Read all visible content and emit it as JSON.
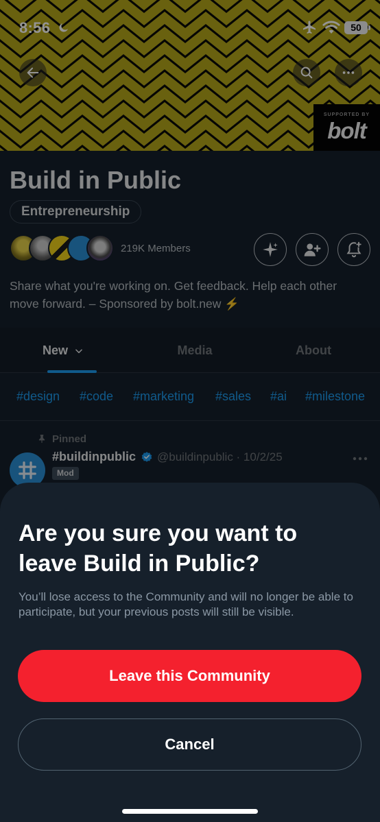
{
  "status_bar": {
    "time": "8:56",
    "battery": "50"
  },
  "banner": {
    "sponsor_small": "SUPPORTED BY",
    "sponsor_logo": "bolt"
  },
  "community": {
    "title": "Build in Public",
    "category": "Entrepreneurship",
    "members": "219K Members",
    "description": "Share what you're working on. Get feedback. Help each other move forward. – Sponsored by bolt.new ⚡"
  },
  "tabs": [
    {
      "label": "New"
    },
    {
      "label": "Media"
    },
    {
      "label": "About"
    }
  ],
  "hashtags": [
    "#design",
    "#code",
    "#marketing",
    "#sales",
    "#ai",
    "#milestone"
  ],
  "post": {
    "pinned_label": "Pinned",
    "author": "#buildinpublic",
    "handle": "@buildinpublic · 10/2/25",
    "badge": "Mod"
  },
  "sheet": {
    "title": "Are you sure you want to leave Build in Public?",
    "body": "You’ll lose access to the Community and will no longer be able to participate, but your previous posts will still be visible.",
    "leave_label": "Leave this Community",
    "cancel_label": "Cancel"
  },
  "colors": {
    "accent": "#1d9bf0",
    "danger": "#f4212e",
    "banner_stripe": "#b5a71a"
  }
}
